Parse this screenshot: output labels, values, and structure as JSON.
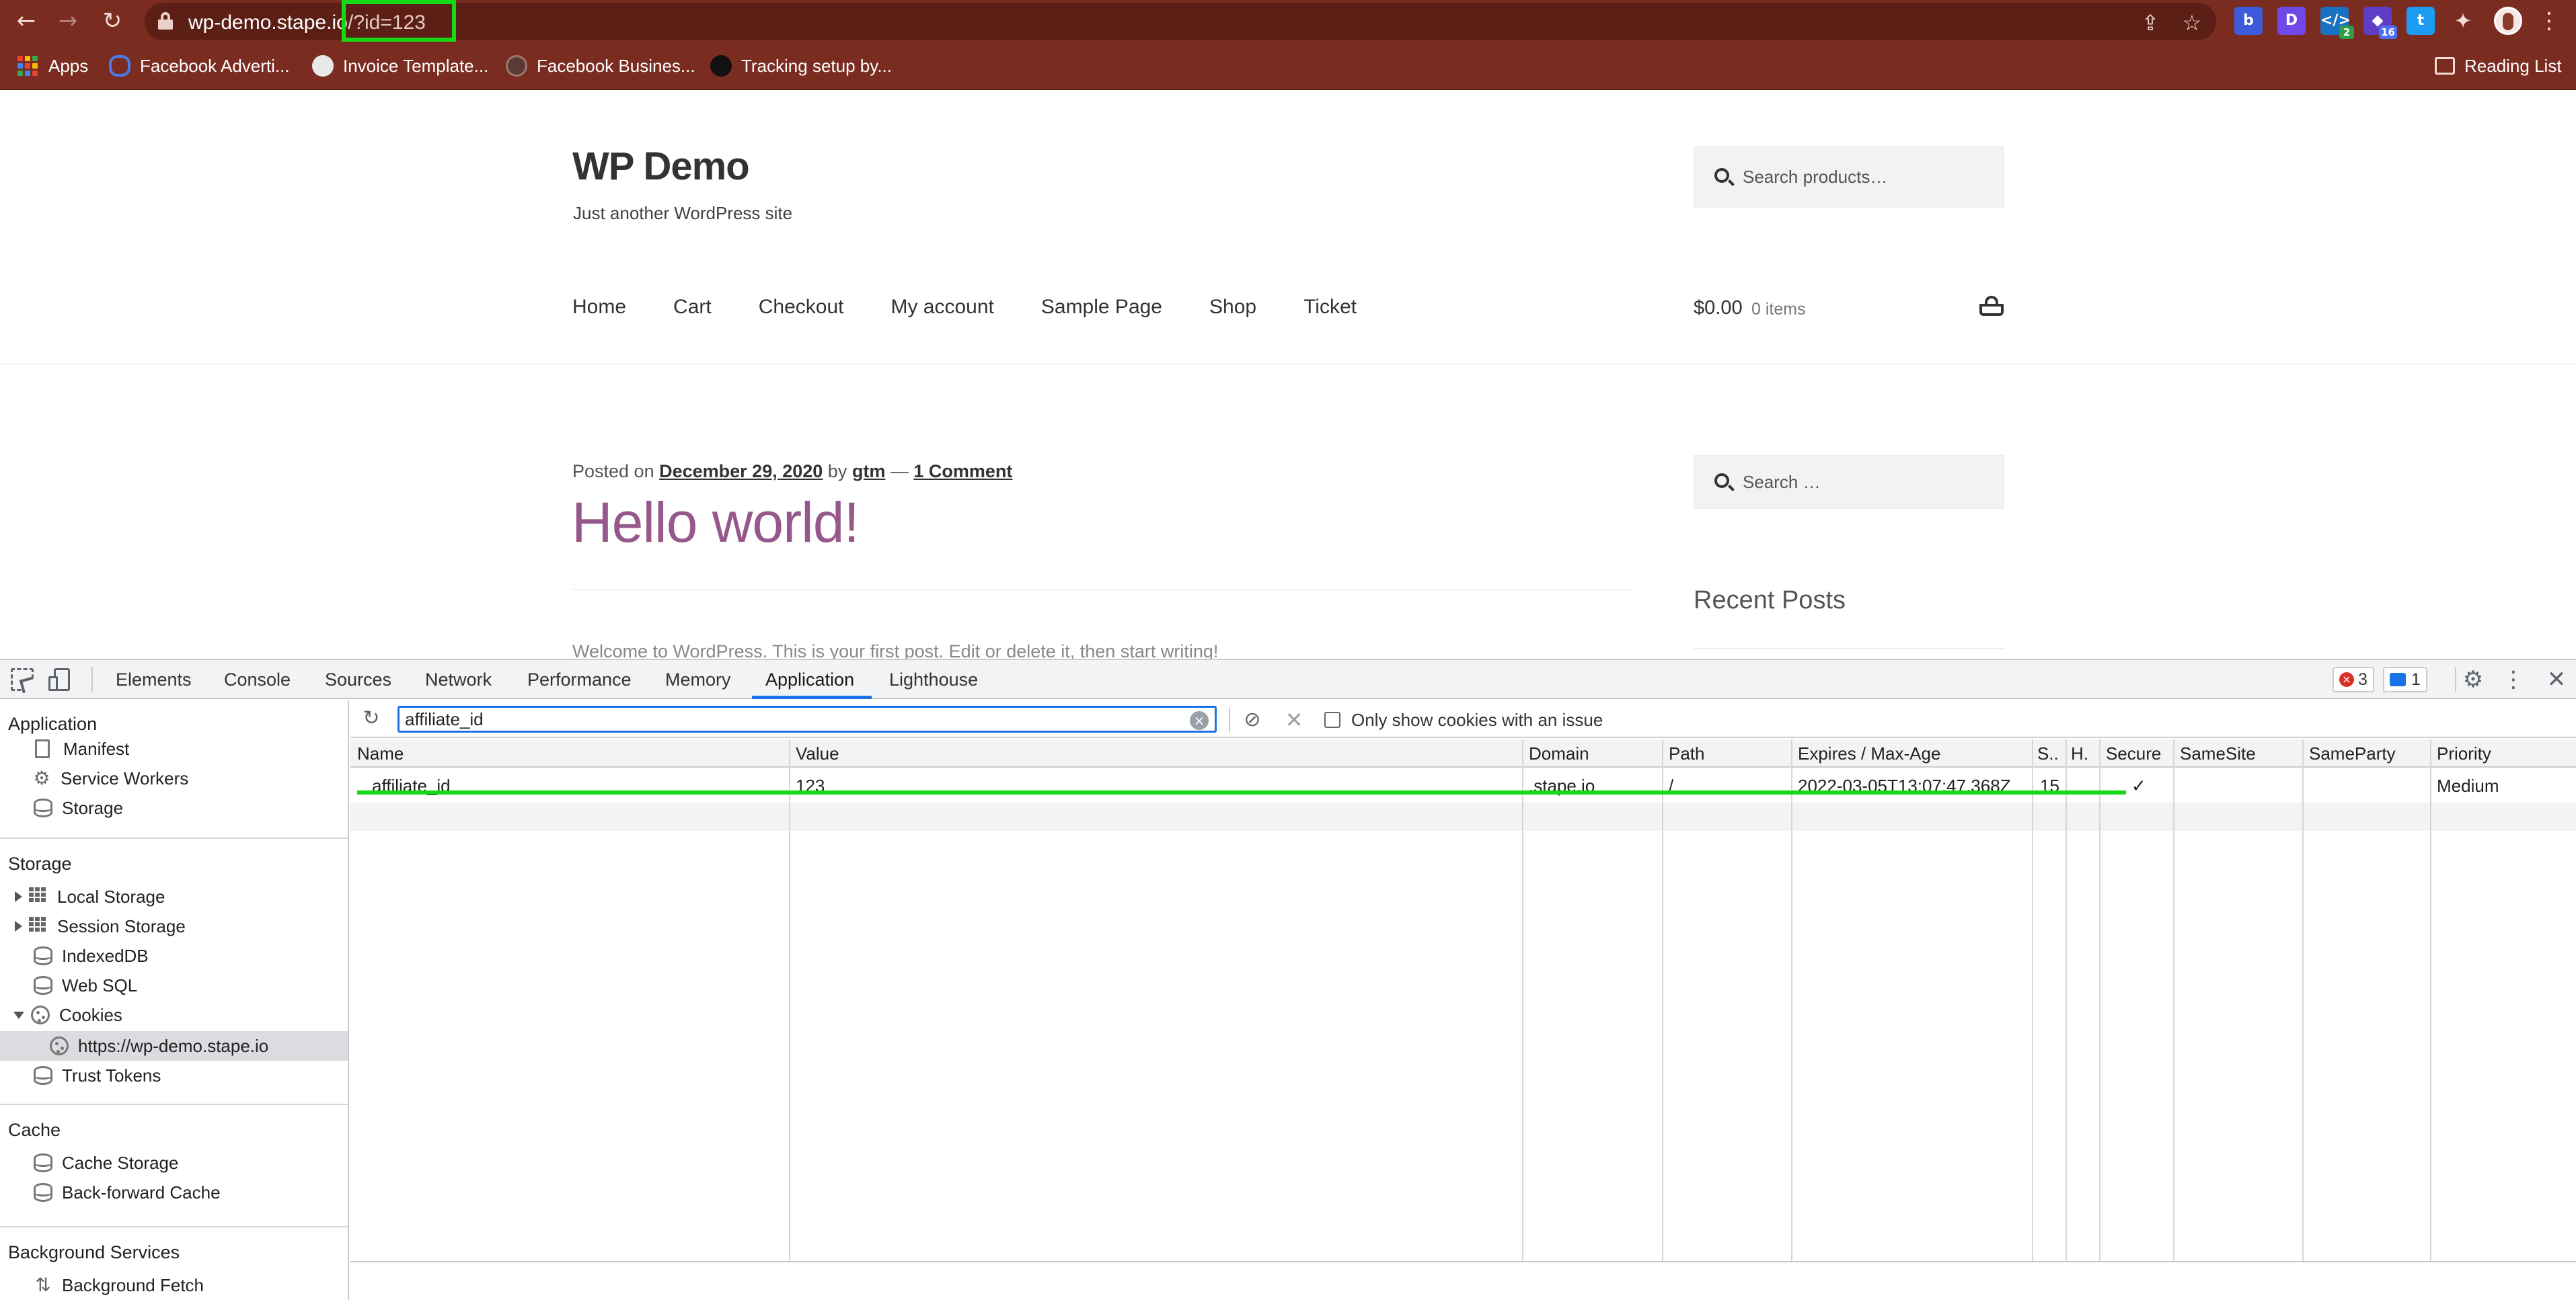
{
  "browser": {
    "url_host": "wp-demo.stape.io",
    "url_path": "/?id=123",
    "bookmarks": [
      {
        "label": "Apps"
      },
      {
        "label": "Facebook Adverti..."
      },
      {
        "label": "Invoice Template..."
      },
      {
        "label": "Facebook Busines..."
      },
      {
        "label": "Tracking setup by..."
      }
    ],
    "reading_list": "Reading List",
    "extensions": [
      {
        "icon": "extension-bitly-icon",
        "glyph": "b",
        "color": "#3b5bdb",
        "badge": ""
      },
      {
        "icon": "extension-d-icon",
        "glyph": "D",
        "color": "#7048e8",
        "badge": ""
      },
      {
        "icon": "extension-tag-assistant-icon",
        "glyph": "</>",
        "color": "#1971c2",
        "badge": "2"
      },
      {
        "icon": "extension-pentagon-icon",
        "glyph": "◆",
        "color": "#5f3dc4",
        "badge": "16"
      },
      {
        "icon": "extension-twitter-icon",
        "glyph": "t",
        "color": "#1d9bf0",
        "badge": ""
      }
    ]
  },
  "site": {
    "title": "WP Demo",
    "tagline": "Just another WordPress site",
    "search_placeholder": "Search products…",
    "nav": [
      "Home",
      "Cart",
      "Checkout",
      "My account",
      "Sample Page",
      "Shop",
      "Ticket"
    ],
    "cart_total": "$0.00",
    "cart_items": "0 items",
    "post_meta": {
      "posted_on": "Posted on",
      "date": "December 29, 2020",
      "by": "by",
      "author": "gtm",
      "dash": "—",
      "comments": "1 Comment"
    },
    "post_title": "Hello world!",
    "post_excerpt": "Welcome to WordPress. This is your first post. Edit or delete it, then start writing!",
    "sidebar_search_placeholder": "Search …",
    "recent_posts": "Recent Posts"
  },
  "devtools": {
    "tabs": [
      "Elements",
      "Console",
      "Sources",
      "Network",
      "Performance",
      "Memory",
      "Application",
      "Lighthouse"
    ],
    "active_tab": "Application",
    "error_count": "3",
    "message_count": "1",
    "sidebar": {
      "application": {
        "title": "Application",
        "items": [
          "Manifest",
          "Service Workers",
          "Storage"
        ]
      },
      "storage": {
        "title": "Storage",
        "items": [
          "Local Storage",
          "Session Storage",
          "IndexedDB",
          "Web SQL",
          "Cookies",
          "https://wp-demo.stape.io",
          "Trust Tokens"
        ]
      },
      "cache": {
        "title": "Cache",
        "items": [
          "Cache Storage",
          "Back-forward Cache"
        ]
      },
      "background": {
        "title": "Background Services",
        "items": [
          "Background Fetch"
        ]
      }
    },
    "cookies": {
      "filter_value": "affiliate_id",
      "only_issue_label": "Only show cookies with an issue",
      "columns": [
        "Name",
        "Value",
        "Domain",
        "Path",
        "Expires / Max-Age",
        "S..",
        "H.",
        "Secure",
        "SameSite",
        "SameParty",
        "Priority"
      ],
      "rows": [
        {
          "name": "affiliate_id",
          "value": "123",
          "domain": ".stape.io",
          "path": "/",
          "expires": "2022-03-05T13:07:47.368Z",
          "size": "15",
          "httponly": "",
          "secure": "✓",
          "samesite": "",
          "sameparty": "",
          "priority": "Medium"
        }
      ]
    }
  },
  "colors": {
    "chrome_bar": "#7a2c21",
    "highlight": "#16d916",
    "post_title": "#96588a",
    "devtools_accent": "#1a73e8"
  }
}
